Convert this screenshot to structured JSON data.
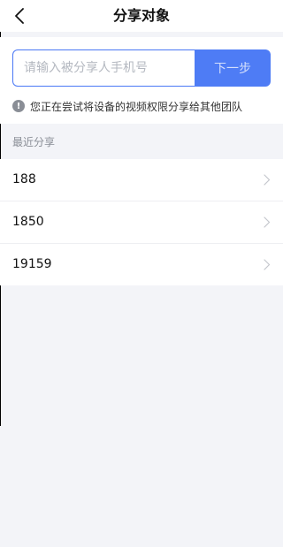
{
  "header": {
    "title": "分享对象",
    "back_icon": "chevron-left-icon"
  },
  "search": {
    "placeholder": "请输入被分享人手机号",
    "value": "",
    "next_label": "下一步"
  },
  "notice": {
    "icon": "info-icon",
    "icon_glyph": "!",
    "text": "您正在尝试将设备的视频权限分享给其他团队"
  },
  "recent": {
    "label": "最近分享",
    "items": [
      {
        "text": "188"
      },
      {
        "text": "1850"
      },
      {
        "text": "19159"
      }
    ]
  },
  "colors": {
    "accent": "#4e7cf5",
    "background": "#f3f4f8"
  }
}
